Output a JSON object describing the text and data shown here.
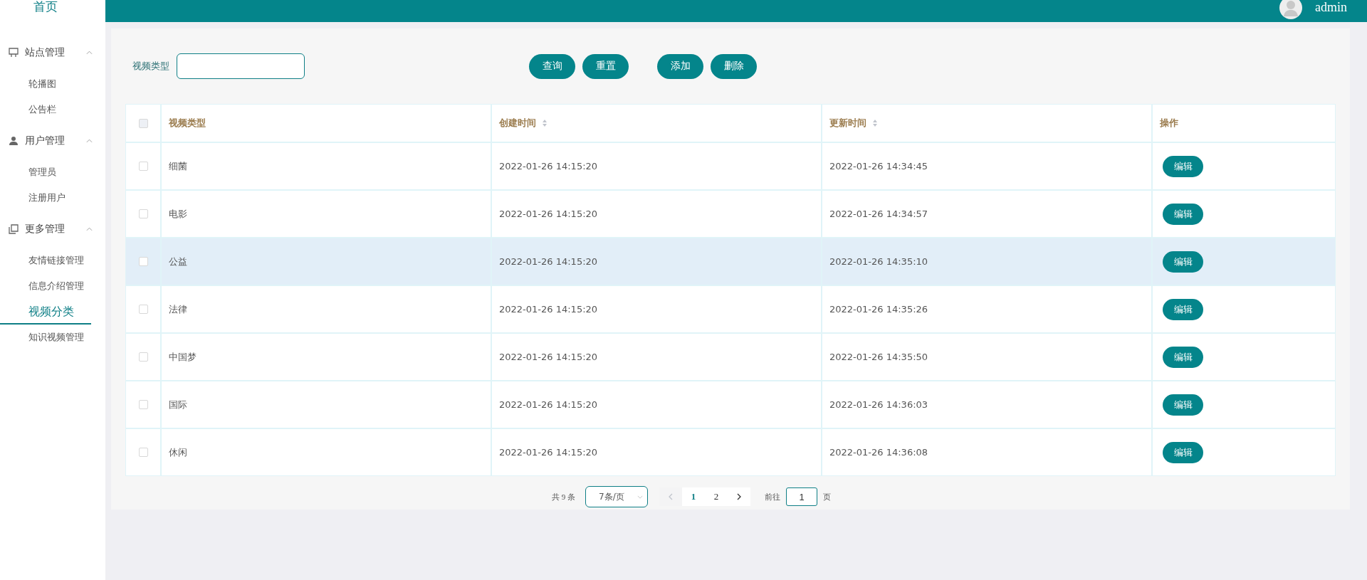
{
  "sidebar": {
    "home": "首页",
    "groups": [
      {
        "title": "站点管理",
        "expanded": true,
        "items": [
          {
            "label": "轮播图",
            "selected": false
          },
          {
            "label": "公告栏",
            "selected": false
          }
        ]
      },
      {
        "title": "用户管理",
        "expanded": true,
        "items": [
          {
            "label": "管理员",
            "selected": false
          },
          {
            "label": "注册用户",
            "selected": false
          }
        ]
      },
      {
        "title": "更多管理",
        "expanded": true,
        "items": [
          {
            "label": "友情链接管理",
            "selected": false
          },
          {
            "label": "信息介绍管理",
            "selected": false
          },
          {
            "label": "视频分类",
            "selected": true
          },
          {
            "label": "知识视频管理",
            "selected": false
          }
        ]
      }
    ]
  },
  "header": {
    "user": "admin"
  },
  "search": {
    "label": "视频类型",
    "buttons": [
      "查询",
      "重置",
      "添加",
      "删除"
    ]
  },
  "table": {
    "columns": [
      {
        "label": "视频类型",
        "sortable": false
      },
      {
        "label": "创建时间",
        "sortable": true
      },
      {
        "label": "更新时间",
        "sortable": true
      },
      {
        "label": "操作",
        "sortable": false
      }
    ],
    "all_checked": false,
    "rows": [
      {
        "checked": false,
        "highlighted": false,
        "type": "细菌",
        "created": "2022-01-26 14:15:20",
        "updated": "2022-01-26 14:34:45",
        "action": "编辑"
      },
      {
        "checked": false,
        "highlighted": false,
        "type": "电影",
        "created": "2022-01-26 14:15:20",
        "updated": "2022-01-26 14:34:57",
        "action": "编辑"
      },
      {
        "checked": false,
        "highlighted": true,
        "type": "公益",
        "created": "2022-01-26 14:15:20",
        "updated": "2022-01-26 14:35:10",
        "action": "编辑"
      },
      {
        "checked": false,
        "highlighted": false,
        "type": "法律",
        "created": "2022-01-26 14:15:20",
        "updated": "2022-01-26 14:35:26",
        "action": "编辑"
      },
      {
        "checked": false,
        "highlighted": false,
        "type": "中国梦",
        "created": "2022-01-26 14:15:20",
        "updated": "2022-01-26 14:35:50",
        "action": "编辑"
      },
      {
        "checked": false,
        "highlighted": false,
        "type": "国际",
        "created": "2022-01-26 14:15:20",
        "updated": "2022-01-26 14:36:03",
        "action": "编辑"
      },
      {
        "checked": false,
        "highlighted": false,
        "type": "休闲",
        "created": "2022-01-26 14:15:20",
        "updated": "2022-01-26 14:36:08",
        "action": "编辑"
      }
    ]
  },
  "pagination": {
    "total": "共 9 条",
    "page_size": "7条/页",
    "pages": [
      {
        "label": "1",
        "selected": true
      },
      {
        "label": "2",
        "selected": false
      }
    ],
    "prev_disabled": true,
    "next_disabled": false,
    "goto_label": "前往",
    "goto_value": "1",
    "goto_suffix": "页"
  }
}
